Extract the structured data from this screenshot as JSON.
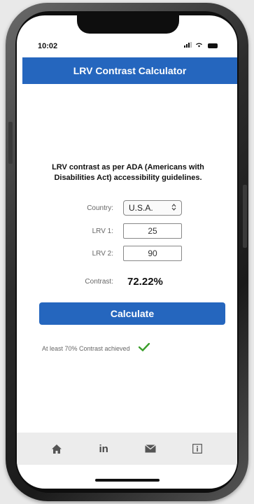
{
  "status": {
    "time": "10:02"
  },
  "header": {
    "title": "LRV Contrast Calculator"
  },
  "intro": {
    "text": "LRV contrast as per ADA (Americans with Disabilities Act) accessibility guidelines."
  },
  "form": {
    "country_label": "Country:",
    "country_value": "U.S.A.",
    "lrv1_label": "LRV 1:",
    "lrv1_value": "25",
    "lrv2_label": "LRV 2:",
    "lrv2_value": "90",
    "contrast_label": "Contrast:",
    "contrast_value": "72.22%"
  },
  "calculate_button": {
    "label": "Calculate"
  },
  "result": {
    "message": "At least 70% Contrast achieved"
  },
  "bottom_nav": {
    "items": [
      {
        "icon": "home-icon"
      },
      {
        "label": "in",
        "icon": "linkedin-icon"
      },
      {
        "icon": "mail-icon"
      },
      {
        "icon": "info-icon"
      }
    ]
  },
  "colors": {
    "accent": "#2566be",
    "success": "#3a9e2a"
  }
}
